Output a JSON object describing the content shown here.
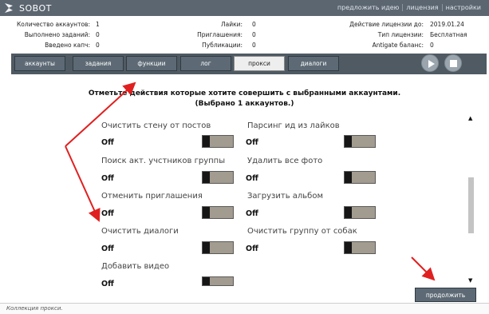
{
  "app": {
    "title": "SOBOT",
    "links": [
      "предложить идею",
      "лицензия",
      "настройки"
    ]
  },
  "info": {
    "accounts_label": "Количество аккаунтов:",
    "accounts_value": "1",
    "tasks_label": "Выполнено заданий:",
    "tasks_value": "0",
    "captcha_label": "Введено капч:",
    "captcha_value": "0",
    "likes_label": "Лайки:",
    "likes_value": "0",
    "invites_label": "Приглашения:",
    "invites_value": "0",
    "posts_label": "Публикации:",
    "posts_value": "0",
    "license_until_label": "Действие лицензии до:",
    "license_until_value": "2019.01.24",
    "license_type_label": "Тип лицензии:",
    "license_type_value": "Бесплатная",
    "antigate_label": "Antigate баланс:",
    "antigate_value": "0"
  },
  "tabs": [
    "аккаунты",
    "задания",
    "функции",
    "лог",
    "прокси",
    "диалоги"
  ],
  "active_tab": "прокси",
  "heading": {
    "line1": "Отметьте действия которые хотите совершить с выбранными аккаунтами.",
    "line2": "(Выбрано 1 аккаунтов.)"
  },
  "options_left": [
    {
      "label": "Очистить стену от постов",
      "state": "Off"
    },
    {
      "label": "Поиск акт. учстников группы",
      "state": "Off"
    },
    {
      "label": "Отменить приглашения",
      "state": "Off"
    },
    {
      "label": "Очистить диалоги",
      "state": "Off"
    },
    {
      "label": "Добавить видео",
      "state": "Off"
    }
  ],
  "options_right": [
    {
      "label": "Парсинг ид из лайков",
      "state": "Off"
    },
    {
      "label": "Удалить все фото",
      "state": "Off"
    },
    {
      "label": "Загрузить альбом",
      "state": "Off"
    },
    {
      "label": "Очистить группу от собак",
      "state": "Off"
    }
  ],
  "continue_label": "продолжить",
  "status_text": "Коллекция прокси.",
  "icons": [
    "logo-icon",
    "play-icon",
    "stop-icon",
    "scroll-up-icon",
    "scroll-down-icon"
  ],
  "colors": {
    "titlebar": "#5c6670",
    "tab": "#5d6a75",
    "toggle": "#a29b8f",
    "arrow": "#e02020"
  }
}
